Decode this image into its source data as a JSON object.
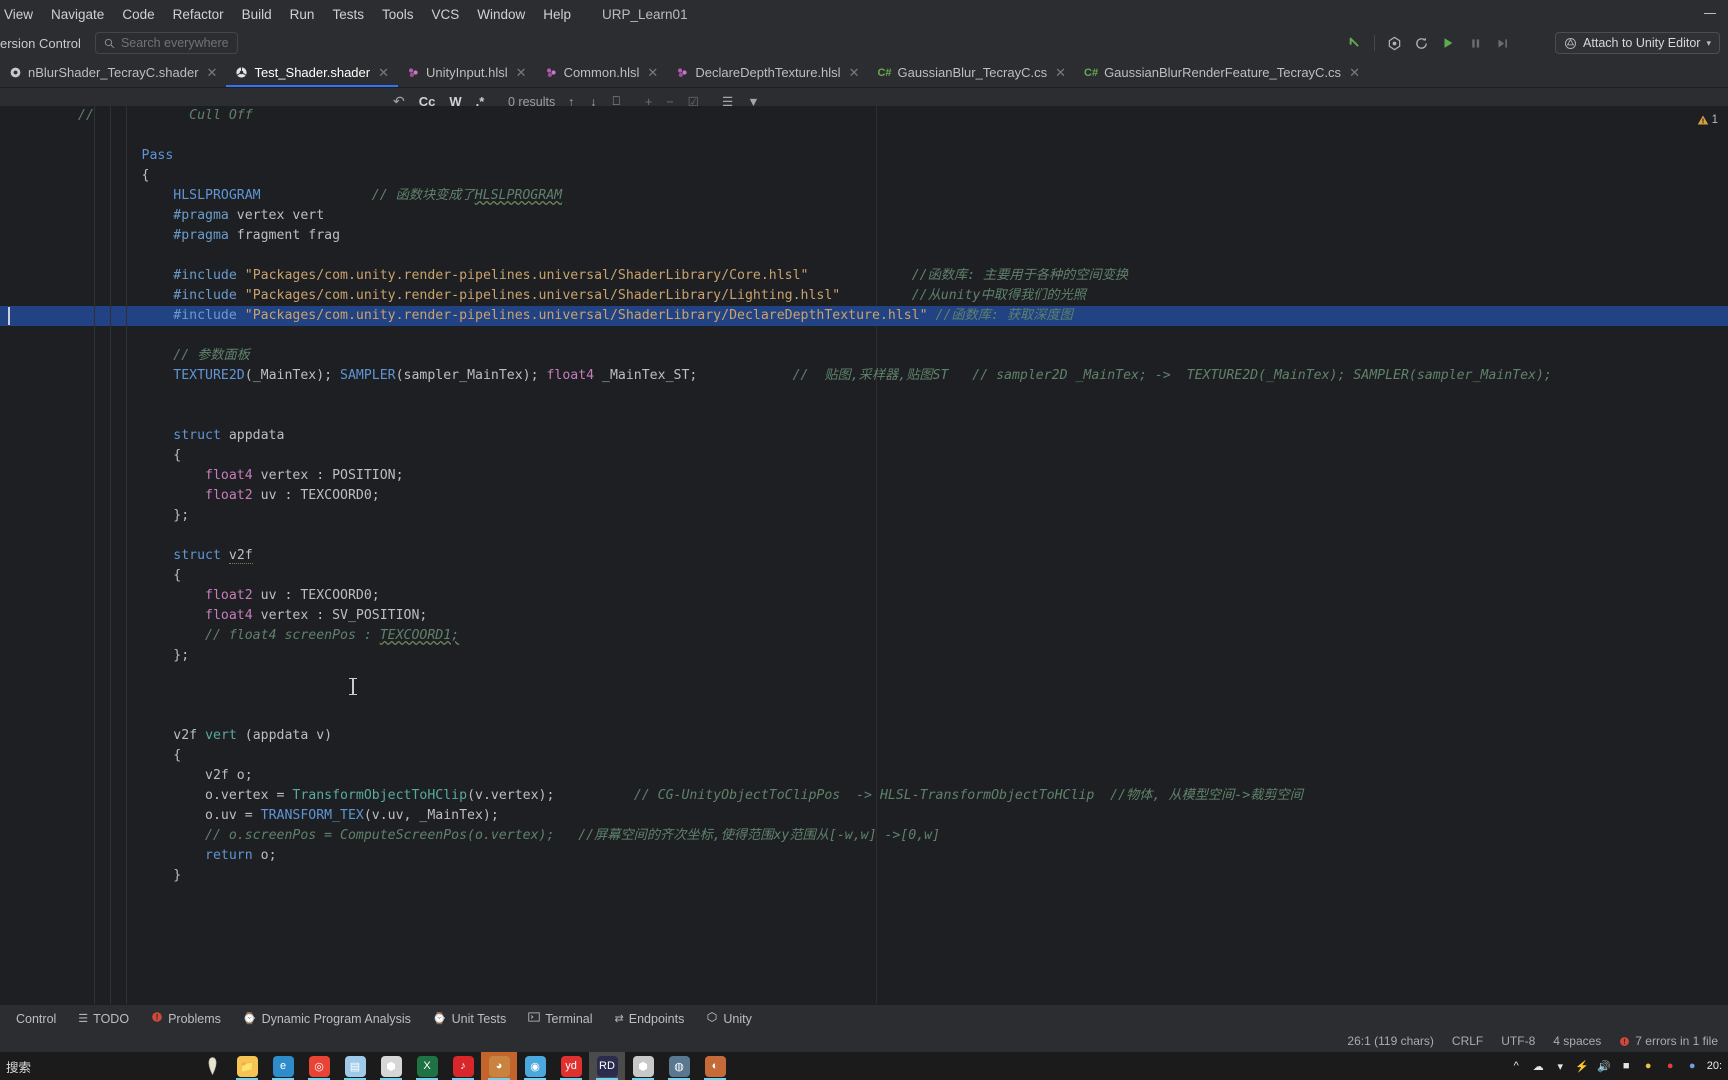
{
  "window": {
    "project_name": "URP_Learn01",
    "minimize_label": "—"
  },
  "menubar": {
    "items": [
      "View",
      "Navigate",
      "Code",
      "Refactor",
      "Build",
      "Run",
      "Tests",
      "Tools",
      "VCS",
      "Window",
      "Help"
    ]
  },
  "navbar": {
    "vcs_label": "ersion Control",
    "search_placeholder": "Search everywhere",
    "search_icon": "search-icon",
    "run_icons": [
      "back-arrow-icon",
      "build-icon",
      "rebuild-icon",
      "run-icon",
      "pause-icon",
      "step-over-icon"
    ],
    "attach_label": "Attach to Unity Editor",
    "attach_icon": "unity-attach-icon",
    "attach_chevron": "▾"
  },
  "tabs": [
    {
      "label": "nBlurShader_TecrayC.shader",
      "icon": "shader-file-icon",
      "active": false,
      "close": "✕"
    },
    {
      "label": "Test_Shader.shader",
      "icon": "unity-shader-icon",
      "active": true,
      "close": "✕"
    },
    {
      "label": "UnityInput.hlsl",
      "icon": "hlsl-file-icon",
      "active": false,
      "close": "✕"
    },
    {
      "label": "Common.hlsl",
      "icon": "hlsl-file-icon",
      "active": false,
      "close": "✕"
    },
    {
      "label": "DeclareDepthTexture.hlsl",
      "icon": "hlsl-file-icon",
      "active": false,
      "close": "✕"
    },
    {
      "label": "GaussianBlur_TecrayC.cs",
      "icon": "csharp-file-icon",
      "active": false,
      "close": "✕"
    },
    {
      "label": "GaussianBlurRenderFeature_TecrayC.cs",
      "icon": "csharp-file-icon",
      "active": false,
      "close": "✕"
    }
  ],
  "findbar": {
    "regex_icon": "regex-icon",
    "match_case_label": "Cc",
    "words_label": "W",
    "regex_label": ".*",
    "results_label": "0 results",
    "prev_icon": "arrow-up-icon",
    "next_icon": "arrow-down-icon",
    "select_all_icon": "select-in-editor-icon",
    "add_icon": "add-line-icon",
    "remove_icon": "remove-line-icon",
    "check_icon": "check-line-icon",
    "preview_icon": "preview-icon",
    "filter_icon": "filter-icon"
  },
  "editor": {
    "warning_count": "1",
    "warning_icon": "warning-triangle-icon",
    "lines": [
      {
        "indent": 0,
        "segments": [
          {
            "t": "//",
            "c": "cmt"
          },
          {
            "t": "            Cull Off",
            "c": "cmt"
          }
        ],
        "raw_prefix": "//"
      },
      {
        "indent": 0,
        "segments": []
      },
      {
        "indent": 0,
        "segments": [
          {
            "t": "        ",
            "c": "id"
          },
          {
            "t": "Pass",
            "c": "kw2"
          }
        ]
      },
      {
        "indent": 0,
        "segments": [
          {
            "t": "        {",
            "c": "id"
          }
        ]
      },
      {
        "indent": 0,
        "segments": [
          {
            "t": "            ",
            "c": "id"
          },
          {
            "t": "HLSLPROGRAM",
            "c": "kw2"
          },
          {
            "t": "              ",
            "c": "id"
          },
          {
            "t": "// 函数块变成了",
            "c": "cmt"
          },
          {
            "t": "HLSLPROGRAM",
            "c": "cmt wavy"
          }
        ]
      },
      {
        "indent": 0,
        "segments": [
          {
            "t": "            ",
            "c": "id"
          },
          {
            "t": "#pragma",
            "c": "pre"
          },
          {
            "t": " vertex vert",
            "c": "id"
          }
        ]
      },
      {
        "indent": 0,
        "segments": [
          {
            "t": "            ",
            "c": "id"
          },
          {
            "t": "#pragma",
            "c": "pre"
          },
          {
            "t": " fragment frag",
            "c": "id"
          }
        ]
      },
      {
        "indent": 0,
        "segments": []
      },
      {
        "indent": 0,
        "segments": [
          {
            "t": "            ",
            "c": "id"
          },
          {
            "t": "#include",
            "c": "pre"
          },
          {
            "t": " \"Packages/com.unity.render-pipelines.universal/ShaderLibrary/Core.hlsl\"",
            "c": "str"
          },
          {
            "t": "             ",
            "c": "id"
          },
          {
            "t": "//函数库: 主要用于各种的空间变换",
            "c": "cmt"
          }
        ]
      },
      {
        "indent": 0,
        "segments": [
          {
            "t": "            ",
            "c": "id"
          },
          {
            "t": "#include",
            "c": "pre"
          },
          {
            "t": " \"Packages/com.unity.render-pipelines.universal/ShaderLibrary/Lighting.hlsl\"",
            "c": "str"
          },
          {
            "t": "         ",
            "c": "id"
          },
          {
            "t": "//从unity中取得我们的光照",
            "c": "cmt"
          }
        ]
      },
      {
        "indent": 0,
        "highlight": true,
        "caret": true,
        "segments": [
          {
            "t": "            ",
            "c": "id"
          },
          {
            "t": "#include",
            "c": "pre"
          },
          {
            "t": " \"Packages/com.unity.render-pipelines.universal/ShaderLibrary/DeclareDepthTexture.hlsl\"",
            "c": "str"
          },
          {
            "t": " ",
            "c": "id"
          },
          {
            "t": "//函数库: 获取深度图",
            "c": "cmt"
          }
        ]
      },
      {
        "indent": 0,
        "segments": []
      },
      {
        "indent": 0,
        "segments": [
          {
            "t": "            ",
            "c": "id"
          },
          {
            "t": "// 参数面板",
            "c": "cmt"
          }
        ]
      },
      {
        "indent": 0,
        "segments": [
          {
            "t": "            ",
            "c": "id"
          },
          {
            "t": "TEXTURE2D",
            "c": "kw2"
          },
          {
            "t": "(_MainTex); ",
            "c": "id"
          },
          {
            "t": "SAMPLER",
            "c": "kw2"
          },
          {
            "t": "(sampler_MainTex); ",
            "c": "id"
          },
          {
            "t": "float4",
            "c": "pl"
          },
          {
            "t": " _MainTex_ST;",
            "c": "id"
          },
          {
            "t": "            ",
            "c": "id"
          },
          {
            "t": "//  贴图,采样器,贴图ST   // sampler2D _MainTex; ->  TEXTURE2D(_MainTex); SAMPLER(sampler_MainTex);",
            "c": "cmt"
          }
        ]
      },
      {
        "indent": 0,
        "segments": []
      },
      {
        "indent": 0,
        "segments": []
      },
      {
        "indent": 0,
        "segments": [
          {
            "t": "            ",
            "c": "id"
          },
          {
            "t": "struct",
            "c": "kw2"
          },
          {
            "t": " appdata",
            "c": "id"
          }
        ]
      },
      {
        "indent": 0,
        "segments": [
          {
            "t": "            {",
            "c": "id"
          }
        ]
      },
      {
        "indent": 0,
        "segments": [
          {
            "t": "                ",
            "c": "id"
          },
          {
            "t": "float4",
            "c": "pl"
          },
          {
            "t": " vertex : POSITION;",
            "c": "id"
          }
        ]
      },
      {
        "indent": 0,
        "segments": [
          {
            "t": "                ",
            "c": "id"
          },
          {
            "t": "float2",
            "c": "pl"
          },
          {
            "t": " uv : TEXCOORD0;",
            "c": "id"
          }
        ]
      },
      {
        "indent": 0,
        "segments": [
          {
            "t": "            };",
            "c": "id"
          }
        ]
      },
      {
        "indent": 0,
        "segments": []
      },
      {
        "indent": 0,
        "segments": [
          {
            "t": "            ",
            "c": "id"
          },
          {
            "t": "struct",
            "c": "kw2"
          },
          {
            "t": " ",
            "c": "id"
          },
          {
            "t": "v2f",
            "c": "id dotted"
          }
        ]
      },
      {
        "indent": 0,
        "segments": [
          {
            "t": "            {",
            "c": "id"
          }
        ]
      },
      {
        "indent": 0,
        "segments": [
          {
            "t": "                ",
            "c": "id"
          },
          {
            "t": "float2",
            "c": "pl"
          },
          {
            "t": " uv : TEXCOORD0;",
            "c": "id"
          }
        ]
      },
      {
        "indent": 0,
        "segments": [
          {
            "t": "                ",
            "c": "id"
          },
          {
            "t": "float4",
            "c": "pl"
          },
          {
            "t": " vertex : SV_POSITION;",
            "c": "id"
          }
        ]
      },
      {
        "indent": 0,
        "segments": [
          {
            "t": "                ",
            "c": "id"
          },
          {
            "t": "// float4 screenPos : ",
            "c": "cmt"
          },
          {
            "t": "TEXCOORD1;",
            "c": "cmt wavy"
          }
        ]
      },
      {
        "indent": 0,
        "segments": [
          {
            "t": "            };",
            "c": "id"
          }
        ]
      },
      {
        "indent": 0,
        "segments": []
      },
      {
        "indent": 0,
        "segments": []
      },
      {
        "indent": 0,
        "segments": []
      },
      {
        "indent": 0,
        "segments": [
          {
            "t": "            ",
            "c": "id"
          },
          {
            "t": "v2f",
            "c": "id"
          },
          {
            "t": " ",
            "c": "id"
          },
          {
            "t": "vert",
            "c": "fn"
          },
          {
            "t": " (appdata v)",
            "c": "id"
          }
        ]
      },
      {
        "indent": 0,
        "segments": [
          {
            "t": "            {",
            "c": "id"
          }
        ]
      },
      {
        "indent": 0,
        "segments": [
          {
            "t": "                ",
            "c": "id"
          },
          {
            "t": "v2f o;",
            "c": "id"
          }
        ]
      },
      {
        "indent": 0,
        "segments": [
          {
            "t": "                ",
            "c": "id"
          },
          {
            "t": "o.vertex = ",
            "c": "id"
          },
          {
            "t": "TransformObjectToHClip",
            "c": "fn"
          },
          {
            "t": "(v.vertex);",
            "c": "id"
          },
          {
            "t": "          ",
            "c": "id"
          },
          {
            "t": "// CG-UnityObjectToClipPos  -> HLSL-TransformObjectToHClip  //物体, 从模型空间->裁剪空间",
            "c": "cmt"
          }
        ]
      },
      {
        "indent": 0,
        "segments": [
          {
            "t": "                ",
            "c": "id"
          },
          {
            "t": "o.uv = ",
            "c": "id"
          },
          {
            "t": "TRANSFORM_TEX",
            "c": "kw2"
          },
          {
            "t": "(v.uv, _MainTex);",
            "c": "id"
          }
        ]
      },
      {
        "indent": 0,
        "segments": [
          {
            "t": "                ",
            "c": "id"
          },
          {
            "t": "// o.screenPos = ComputeScreenPos(o.vertex);   //屏幕空间的齐次坐标,使得范围xy范围从[-w,w] ->[0,w]",
            "c": "cmt"
          }
        ]
      },
      {
        "indent": 0,
        "segments": [
          {
            "t": "                ",
            "c": "id"
          },
          {
            "t": "return",
            "c": "kw2"
          },
          {
            "t": " o;",
            "c": "id"
          }
        ]
      },
      {
        "indent": 0,
        "segments": [
          {
            "t": "            }",
            "c": "id"
          }
        ]
      }
    ]
  },
  "toolwindows": [
    {
      "label": "Control",
      "icon": "vcs-icon"
    },
    {
      "label": "TODO",
      "icon": "todo-icon"
    },
    {
      "label": "Problems",
      "icon": "problems-icon"
    },
    {
      "label": "Dynamic Program Analysis",
      "icon": "dpa-icon"
    },
    {
      "label": "Unit Tests",
      "icon": "unit-tests-icon"
    },
    {
      "label": "Terminal",
      "icon": "terminal-icon"
    },
    {
      "label": "Endpoints",
      "icon": "endpoints-icon"
    },
    {
      "label": "Unity",
      "icon": "unity-icon"
    }
  ],
  "statusbar": {
    "caret_position": "26:1 (119 chars)",
    "line_separator": "CRLF",
    "encoding": "UTF-8",
    "indent": "4 spaces",
    "errors": "7 errors in 1 file",
    "error_icon": "error-circle-icon"
  },
  "taskbar": {
    "search_text": "搜索",
    "search_icon": "search-icon",
    "apps": [
      {
        "name": "file-explorer",
        "glyph": "📁",
        "color": "#f6c455",
        "state": "open"
      },
      {
        "name": "microsoft-edge",
        "glyph": "e",
        "color": "#2e8ccb",
        "state": "open"
      },
      {
        "name": "google-chrome",
        "glyph": "◎",
        "color": "#e94335",
        "state": "open"
      },
      {
        "name": "notes-app",
        "glyph": "▤",
        "color": "#9ec9e8",
        "state": "open"
      },
      {
        "name": "unity-hub",
        "glyph": "⬢",
        "color": "#d6d6d6",
        "state": "open"
      },
      {
        "name": "microsoft-excel",
        "glyph": "X",
        "color": "#1f7244",
        "state": "open"
      },
      {
        "name": "netease-music",
        "glyph": "♪",
        "color": "#d8272b",
        "state": "open"
      },
      {
        "name": "image-viewer",
        "glyph": "◕",
        "color": "#c9823f",
        "state": "active"
      },
      {
        "name": "bilibili",
        "glyph": "◉",
        "color": "#4aa8dd",
        "state": "open"
      },
      {
        "name": "youdao-dict",
        "glyph": "yd",
        "color": "#e03030",
        "state": "open"
      },
      {
        "name": "jetbrains-rider",
        "glyph": "RD",
        "color": "#2b2b4d",
        "state": "sel"
      },
      {
        "name": "unity-editor",
        "glyph": "⬢",
        "color": "#c8c8c8",
        "state": "open"
      },
      {
        "name": "steam",
        "glyph": "◍",
        "color": "#59778f",
        "state": "open"
      },
      {
        "name": "media-player",
        "glyph": "◐",
        "color": "#c76a3a",
        "state": "open"
      }
    ],
    "tray_icons": [
      "chevron-up-icon",
      "onedrive-icon",
      "network-icon",
      "bluetooth-icon",
      "volume-icon",
      "battery-icon",
      "input-method-icon",
      "ime-icon",
      "shield-icon"
    ],
    "clock_time": "20:",
    "clock_date": ""
  }
}
